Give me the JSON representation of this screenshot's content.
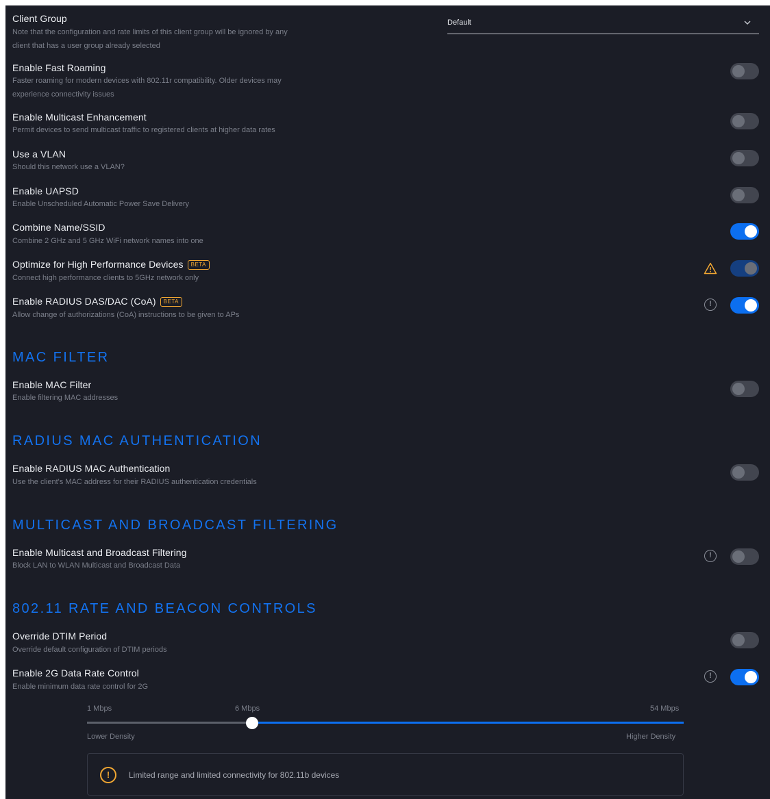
{
  "client_group": {
    "title": "Client Group",
    "desc_line1": "Note that the configuration and rate limits of this client group will be ignored by any",
    "desc_line2": "client that has a user group already selected",
    "selected": "Default"
  },
  "settings": [
    {
      "title": "Enable Fast Roaming",
      "desc1": "Faster roaming for modern devices with 802.11r compatibility. Older devices may",
      "desc2": "experience connectivity issues",
      "enabled": false
    },
    {
      "title": "Enable Multicast Enhancement",
      "desc1": "Permit devices to send multicast traffic to registered clients at higher data rates",
      "enabled": false
    },
    {
      "title": "Use a VLAN",
      "desc1": "Should this network use a VLAN?",
      "enabled": false
    },
    {
      "title": "Enable UAPSD",
      "desc1": "Enable Unscheduled Automatic Power Save Delivery",
      "enabled": false
    },
    {
      "title": "Combine Name/SSID",
      "desc1": "Combine 2 GHz and 5 GHz WiFi network names into one",
      "enabled": true
    },
    {
      "title": "Optimize for High Performance Devices",
      "badge": "BETA",
      "desc1": "Connect high performance clients to 5GHz network only",
      "enabled": true,
      "icon": "warning-icon"
    },
    {
      "title": "Enable RADIUS DAS/DAC (CoA)",
      "badge": "BETA",
      "desc1": "Allow change of authorizations (CoA) instructions to be given to APs",
      "enabled": true,
      "icon": "info-icon"
    }
  ],
  "sections": {
    "mac_filter": {
      "heading": "MAC FILTER",
      "title": "Enable MAC Filter",
      "desc": "Enable filtering MAC addresses",
      "enabled": false
    },
    "radius_mac": {
      "heading": "RADIUS MAC AUTHENTICATION",
      "title": "Enable RADIUS MAC Authentication",
      "desc": "Use the client's MAC address for their RADIUS authentication credentials",
      "enabled": false
    },
    "multicast": {
      "heading": "MULTICAST AND BROADCAST FILTERING",
      "title": "Enable Multicast and Broadcast Filtering",
      "desc": "Block LAN to WLAN Multicast and Broadcast Data",
      "enabled": false
    },
    "rate_beacon": {
      "heading": "802.11 RATE AND BEACON CONTROLS",
      "dtim_title": "Override DTIM Period",
      "dtim_desc": "Override default configuration of DTIM periods",
      "dtim_enabled": false,
      "rate_title": "Enable 2G Data Rate Control",
      "rate_desc": "Enable minimum data rate control for 2G",
      "rate_enabled": true
    }
  },
  "slider": {
    "min_label": "1 Mbps",
    "current_label": "6 Mbps",
    "max_label": "54 Mbps",
    "value_mbps": 6,
    "left_caption": "Lower Density",
    "right_caption": "Higher Density"
  },
  "notice": {
    "message": "Limited range and limited connectivity for 802.11b devices"
  },
  "colors": {
    "background": "#1b1d26",
    "accent": "#0c6ff0",
    "section_heading": "#1372ef",
    "warning": "#f0a632",
    "toggle_off": "#42454f"
  }
}
